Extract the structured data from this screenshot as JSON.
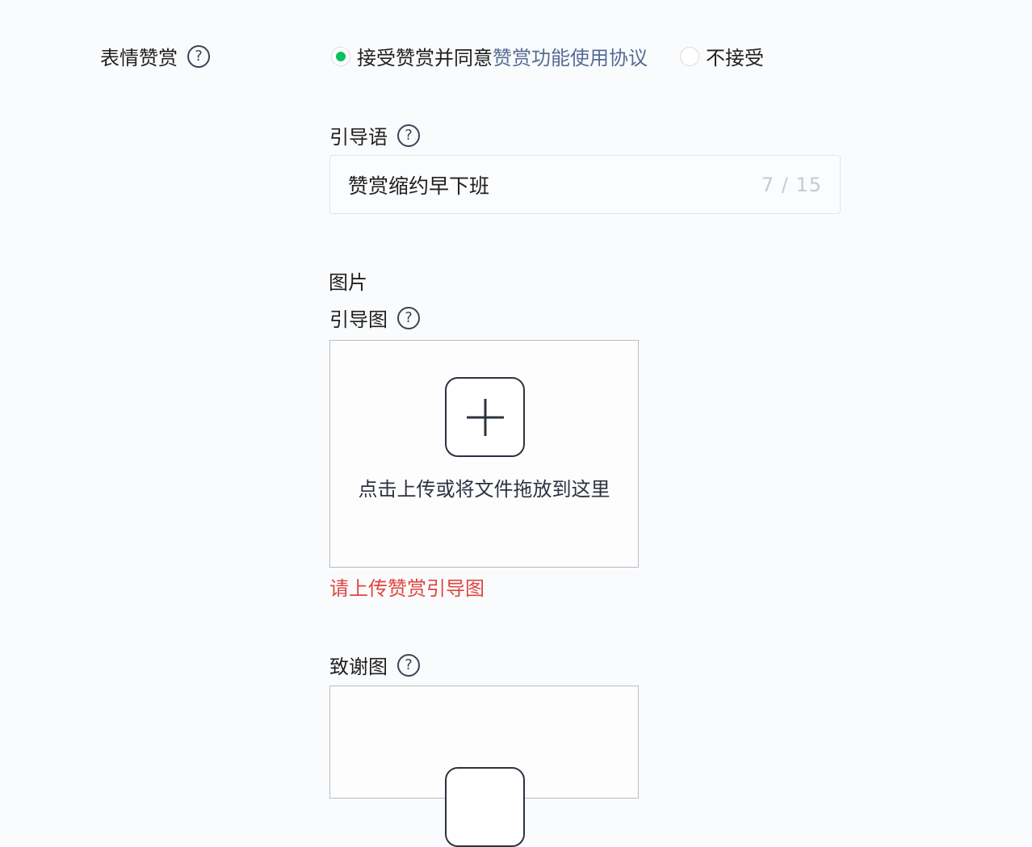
{
  "reward": {
    "title": "表情赞赏",
    "option_accept": "接受赞赏并同意",
    "agreement_link": "赞赏功能使用协议",
    "option_reject": "不接受",
    "accent_color": "#07c160",
    "link_color": "#576b95"
  },
  "guide_text": {
    "label": "引导语",
    "value": "赞赏缩约早下班",
    "counter": "7 / 15"
  },
  "image_section": {
    "title": "图片",
    "guide_image_label": "引导图",
    "upload_hint": "点击上传或将文件拖放到这里",
    "error": "请上传赞赏引导图",
    "error_color": "#e0453f",
    "thanks_image_label": "致谢图"
  },
  "icons": {
    "help": "?",
    "help_name": "help-icon",
    "plus_name": "plus-icon"
  }
}
